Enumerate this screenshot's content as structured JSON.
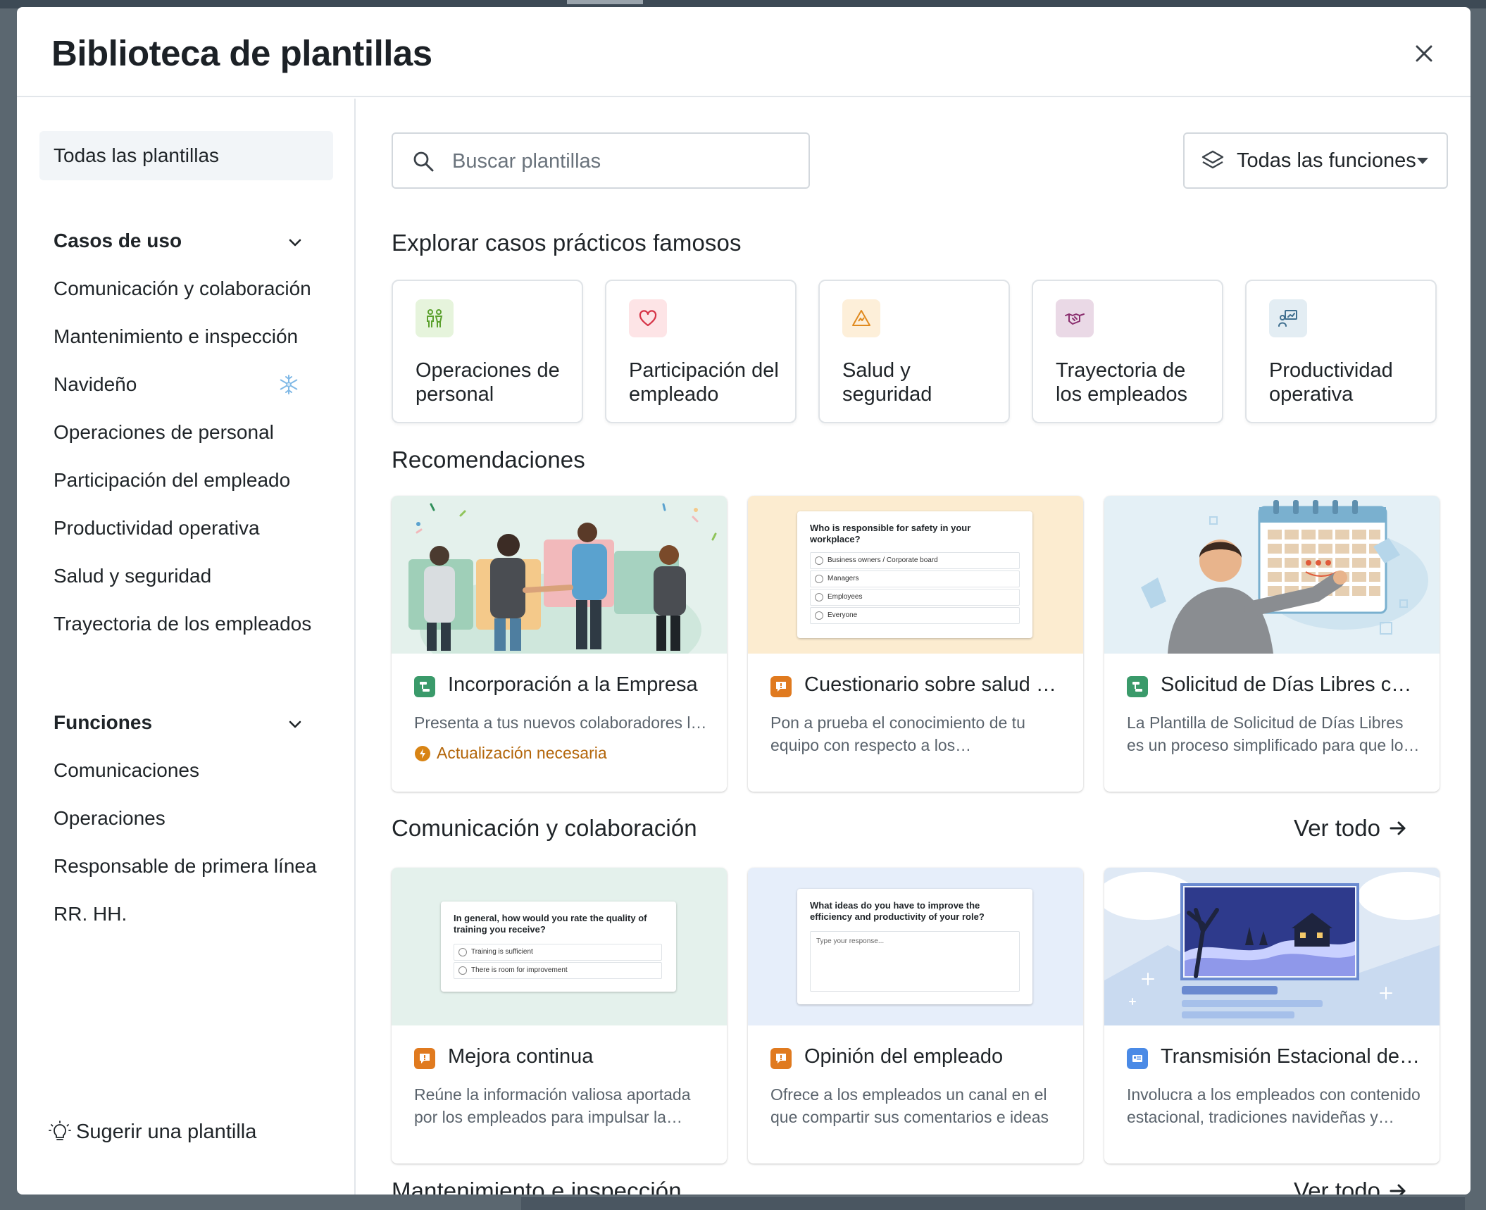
{
  "modal": {
    "title": "Biblioteca de plantillas"
  },
  "sidebar": {
    "all_label": "Todas las plantillas",
    "use_cases_title": "Casos de uso",
    "use_cases": [
      "Comunicación y colaboración",
      "Mantenimiento e inspección",
      "Navideño",
      "Operaciones de personal",
      "Participación del empleado",
      "Productividad operativa",
      "Salud y seguridad",
      "Trayectoria de los empleados"
    ],
    "functions_title": "Funciones",
    "functions": [
      "Comunicaciones",
      "Operaciones",
      "Responsable de primera línea",
      "RR. HH."
    ],
    "suggest_label": "Sugerir una plantilla"
  },
  "search": {
    "placeholder": "Buscar plantillas"
  },
  "function_filter": {
    "selected": "Todas las funciones"
  },
  "explore": {
    "heading": "Explorar casos prácticos famosos",
    "cards": [
      {
        "label": "Operaciones de personal",
        "icon": "people-icon",
        "bg": "#e6f4dc",
        "color": "#5aa02c"
      },
      {
        "label": "Participación del empleado",
        "icon": "heart-icon",
        "bg": "#fde4e6",
        "color": "#d63447"
      },
      {
        "label": "Salud y seguridad",
        "icon": "warning-icon",
        "bg": "#fdefd9",
        "color": "#e08a1e"
      },
      {
        "label": "Trayectoria de los empleados",
        "icon": "handshake-icon",
        "bg": "#ead9e6",
        "color": "#8a2e6e"
      },
      {
        "label": "Productividad operativa",
        "icon": "presentation-icon",
        "bg": "#e3edf3",
        "color": "#3f6f8f"
      }
    ]
  },
  "recommendations": {
    "heading": "Recomendaciones",
    "cards": [
      {
        "title": "Incorporación a la Empresa",
        "desc": "Presenta a tus nuevos colaboradores los valores y la cultura de tu empresa",
        "type_icon": "flow-icon",
        "type_color": "#3a9a6a",
        "update": "Actualización necesaria"
      },
      {
        "title": "Cuestionario sobre salud y seguridad",
        "desc": "Pon a prueba el conocimiento de tu equipo con respecto a los procedimientos de seguridad",
        "type_icon": "quiz-icon",
        "type_color": "#e07a1f",
        "mock_question": "Who is responsible for safety in your workplace?",
        "mock_options": [
          "Business owners / Corporate board",
          "Managers",
          "Employees",
          "Everyone"
        ]
      },
      {
        "title": "Solicitud de Días Libres con aprobación",
        "desc": "La Plantilla de Solicitud de Días Libres es un proceso simplificado para que los empleados",
        "type_icon": "flow-icon",
        "type_color": "#3a9a6a"
      }
    ]
  },
  "communication": {
    "heading": "Comunicación y colaboración",
    "see_all": "Ver todo",
    "cards": [
      {
        "title": "Mejora continua",
        "desc": "Reúne la información valiosa aportada por los empleados para impulsar la mejora continua",
        "type_icon": "quiz-icon",
        "type_color": "#e07a1f",
        "mock_question": "In general, how would you rate the quality of training you receive?",
        "mock_options": [
          "Training is sufficient",
          "There is room for improvement"
        ]
      },
      {
        "title": "Opinión del empleado",
        "desc": "Ofrece a los empleados un canal en el que compartir sus comentarios e ideas",
        "type_icon": "quiz-icon",
        "type_color": "#e07a1f",
        "mock_question": "What ideas do you have to improve the efficiency and productivity of your role?",
        "mock_placeholder": "Type your response..."
      },
      {
        "title": "Transmisión Estacional de Navidad",
        "desc": "Involucra a los empleados con contenido estacional, tradiciones navideñas y celebraciones",
        "type_icon": "broadcast-icon",
        "type_color": "#4a8ae6"
      }
    ]
  },
  "maintenance": {
    "heading": "Mantenimiento e inspección",
    "see_all": "Ver todo"
  }
}
